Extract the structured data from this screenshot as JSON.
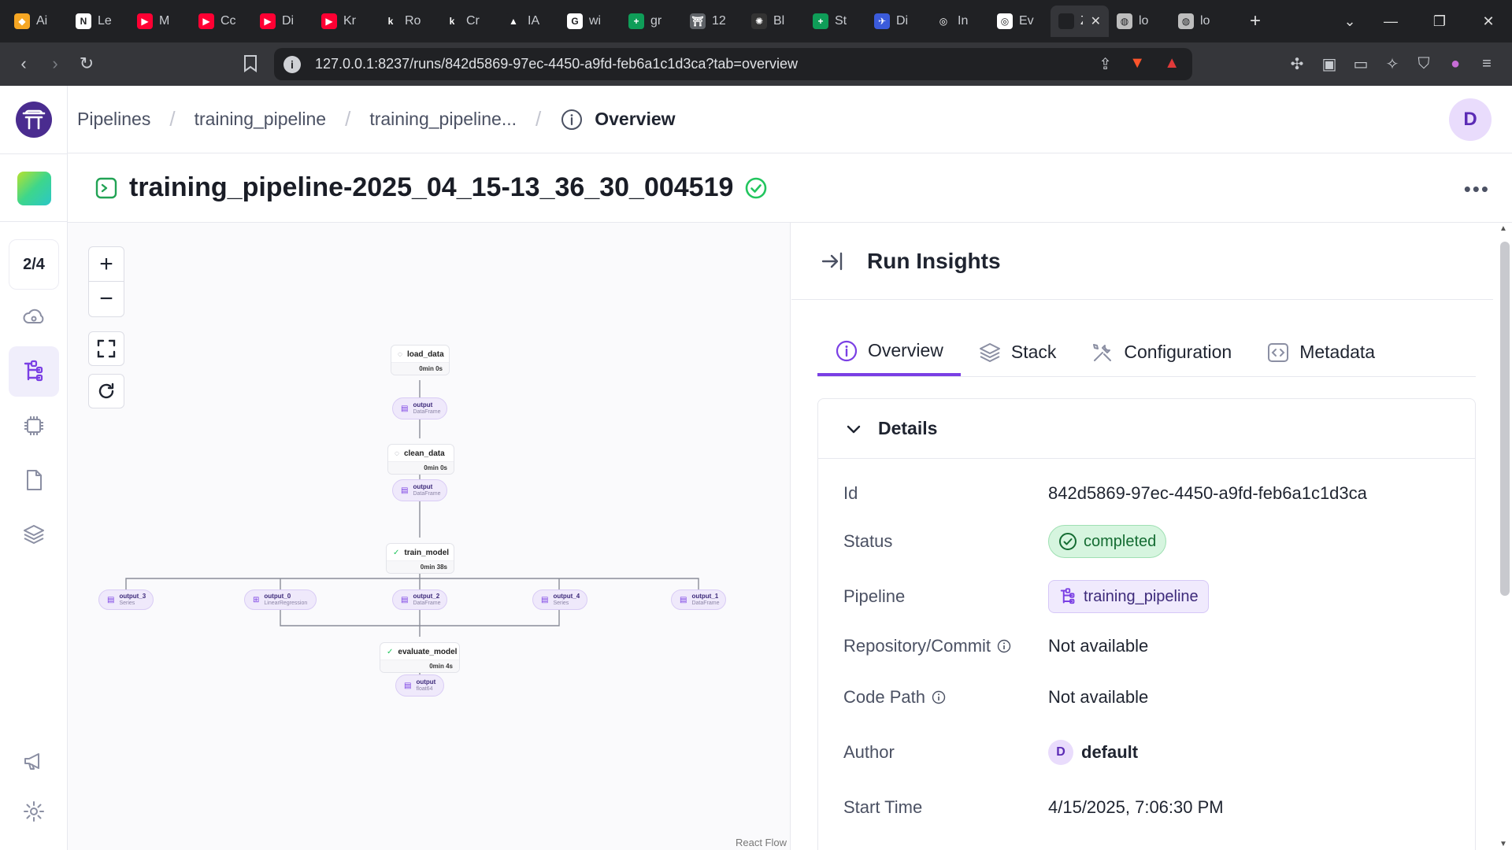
{
  "browser": {
    "tabs": [
      {
        "title": "Ai",
        "color": "#f5a623",
        "glyph": "◆"
      },
      {
        "title": "Le",
        "color": "#ffffff",
        "glyph": "N"
      },
      {
        "title": "M",
        "color": "#ff0033",
        "glyph": "▶"
      },
      {
        "title": "Cc",
        "color": "#ff0033",
        "glyph": "▶"
      },
      {
        "title": "Di",
        "color": "#ff0033",
        "glyph": "▶"
      },
      {
        "title": "Kr",
        "color": "#ff0033",
        "glyph": "▶"
      },
      {
        "title": "Ro",
        "color": "#202124",
        "glyph": "k"
      },
      {
        "title": "Cr",
        "color": "#202124",
        "glyph": "k"
      },
      {
        "title": "IA",
        "color": "#202124",
        "glyph": "▲"
      },
      {
        "title": "wi",
        "color": "#ffffff",
        "glyph": "G"
      },
      {
        "title": "gr",
        "color": "#0f9d58",
        "glyph": "+"
      },
      {
        "title": "12",
        "color": "#5f6368",
        "glyph": "⛩"
      },
      {
        "title": "Bl",
        "color": "#333333",
        "glyph": "✺"
      },
      {
        "title": "St",
        "color": "#0f9d58",
        "glyph": "+"
      },
      {
        "title": "Di",
        "color": "#3b5bdb",
        "glyph": "✈"
      },
      {
        "title": "In",
        "color": "#202124",
        "glyph": "◎"
      },
      {
        "title": "Ev",
        "color": "#ffffff",
        "glyph": "◎"
      },
      {
        "title": "Ze",
        "color": "#202124",
        "glyph": ""
      },
      {
        "title": "lo",
        "color": "#bdbdbd",
        "glyph": "◍"
      },
      {
        "title": "lo",
        "color": "#bdbdbd",
        "glyph": "◍"
      }
    ],
    "url": "127.0.0.1:8237/runs/842d5869-97ec-4450-a9fd-feb6a1c1d3ca?tab=overview"
  },
  "breadcrumb": {
    "items": [
      "Pipelines",
      "training_pipeline",
      "training_pipeline...",
      "Overview"
    ]
  },
  "user": {
    "initial": "D"
  },
  "rail": {
    "counter": "2/4"
  },
  "run": {
    "title": "training_pipeline-2025_04_15-13_36_30_004519",
    "more": "•••"
  },
  "dag": {
    "steps": {
      "load_data": {
        "name": "load_data",
        "time": "0min 0s"
      },
      "clean_data": {
        "name": "clean_data",
        "time": "0min 0s"
      },
      "train_model": {
        "name": "train_model",
        "time": "0min 38s"
      },
      "evaluate_model": {
        "name": "evaluate_model",
        "time": "0min 4s"
      }
    },
    "artifacts": {
      "a1": {
        "name": "output",
        "type": "DataFrame"
      },
      "a2": {
        "name": "output",
        "type": "DataFrame"
      },
      "a3": {
        "name": "output_3",
        "type": "Series"
      },
      "a4": {
        "name": "output_0",
        "type": "LinearRegression"
      },
      "a5": {
        "name": "output_2",
        "type": "DataFrame"
      },
      "a6": {
        "name": "output_4",
        "type": "Series"
      },
      "a7": {
        "name": "output_1",
        "type": "DataFrame"
      },
      "a8": {
        "name": "output",
        "type": "float64"
      }
    },
    "attribution": "React Flow"
  },
  "insights": {
    "title": "Run Insights",
    "tabs": [
      "Overview",
      "Stack",
      "Configuration",
      "Metadata"
    ],
    "details": {
      "heading": "Details",
      "id_label": "Id",
      "id_value": "842d5869-97ec-4450-a9fd-feb6a1c1d3ca",
      "status_label": "Status",
      "status_value": "completed",
      "pipeline_label": "Pipeline",
      "pipeline_value": "training_pipeline",
      "repo_label": "Repository/Commit",
      "repo_value": "Not available",
      "codepath_label": "Code Path",
      "codepath_value": "Not available",
      "author_label": "Author",
      "author_initial": "D",
      "author_value": "default",
      "start_label": "Start Time",
      "start_value": "4/15/2025, 7:06:30 PM"
    }
  },
  "colors": {
    "accent": "#7a3fe4",
    "success": "#22c55e",
    "artifact_bg": "#efe9fb"
  }
}
